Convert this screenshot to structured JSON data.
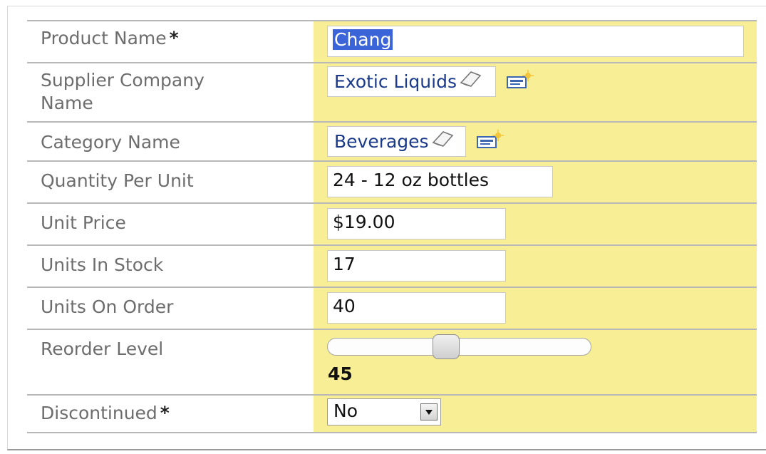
{
  "form": {
    "required_marker": "*",
    "fields": {
      "product_name": {
        "label": "Product Name",
        "value": "Chang"
      },
      "supplier": {
        "label_line1": "Supplier Company",
        "label_line2": "Name",
        "value": "Exotic Liquids"
      },
      "category": {
        "label": "Category Name",
        "value": "Beverages"
      },
      "quantity_per_unit": {
        "label": "Quantity Per Unit",
        "value": "24 - 12 oz bottles"
      },
      "unit_price": {
        "label": "Unit Price",
        "value": "$19.00"
      },
      "units_in_stock": {
        "label": "Units In Stock",
        "value": "17"
      },
      "units_on_order": {
        "label": "Units On Order",
        "value": "40"
      },
      "reorder_level": {
        "label": "Reorder Level",
        "value": "45",
        "slider_fraction": 0.45
      },
      "discontinued": {
        "label": "Discontinued",
        "value": "No"
      }
    }
  },
  "colors": {
    "field_column_bg": "#f8ee96",
    "label_text": "#6d6d6d",
    "selection_bg": "#3a64d8",
    "link_text": "#1b3a8a"
  },
  "icons": [
    "eraser-icon",
    "new-record-icon",
    "dropdown-arrow-icon"
  ]
}
